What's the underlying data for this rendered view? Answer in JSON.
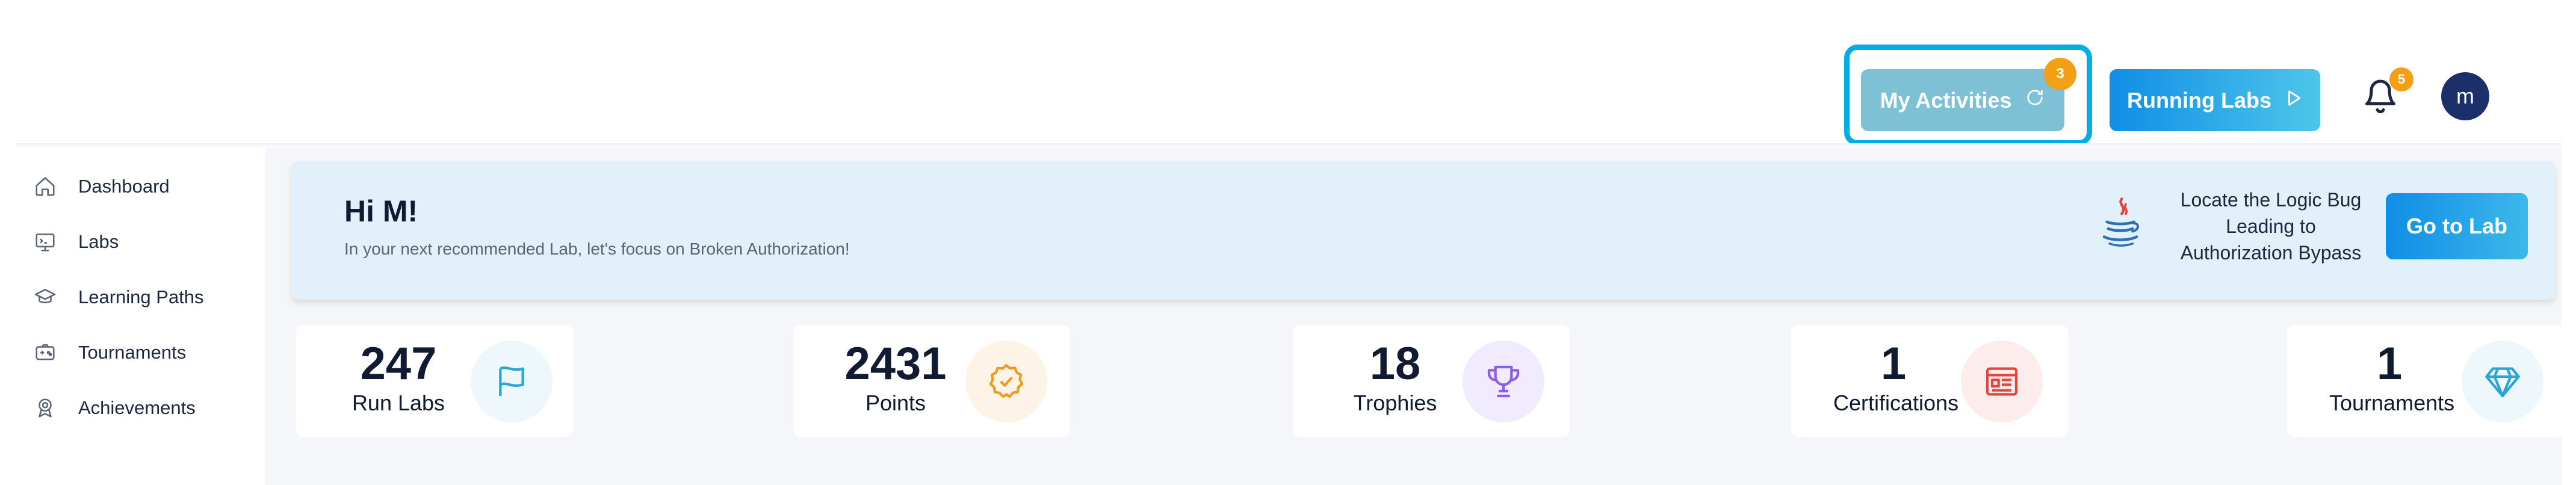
{
  "topbar": {
    "activities_label": "My Activities",
    "activities_badge": "3",
    "running_label": "Running Labs",
    "notifications_badge": "5",
    "avatar_initial": "m"
  },
  "sidebar": {
    "items": [
      {
        "label": "Dashboard",
        "icon": "home-icon"
      },
      {
        "label": "Labs",
        "icon": "monitor-icon"
      },
      {
        "label": "Learning Paths",
        "icon": "graduation-cap-icon"
      },
      {
        "label": "Tournaments",
        "icon": "gamepad-icon"
      },
      {
        "label": "Achievements",
        "icon": "medal-icon"
      }
    ]
  },
  "banner": {
    "greeting": "Hi M!",
    "subtitle": "In your next recommended Lab, let's focus on Broken Authorization!",
    "lab_title": "Locate the Logic Bug Leading to Authorization Bypass",
    "lab_icon": "java-icon",
    "go_button": "Go to Lab"
  },
  "stats": [
    {
      "value": "247",
      "label": "Run Labs",
      "icon": "flag-icon",
      "color": "#2aa5d6"
    },
    {
      "value": "2431",
      "label": "Points",
      "icon": "badge-check-icon",
      "color": "#f09a22"
    },
    {
      "value": "18",
      "label": "Trophies",
      "icon": "trophy-icon",
      "color": "#8a5cf0"
    },
    {
      "value": "1",
      "label": "Certifications",
      "icon": "certificate-icon",
      "color": "#e2463f"
    },
    {
      "value": "1",
      "label": "Tournaments",
      "icon": "diamond-icon",
      "color": "#2aa5d6"
    }
  ],
  "colors": {
    "accent": "#0f8ee6",
    "highlight_outline": "#00aee5",
    "badge": "#f4a017",
    "avatar": "#1d2f6a",
    "banner_bg": "#e2f1f9"
  }
}
